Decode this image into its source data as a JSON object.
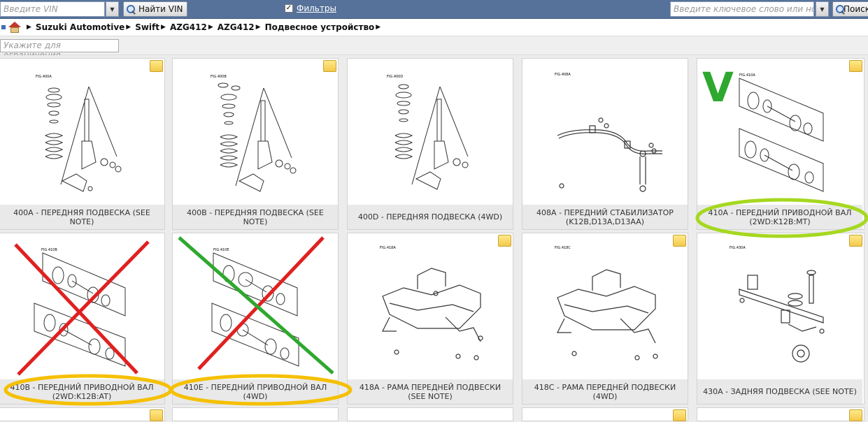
{
  "toolbar": {
    "vin_placeholder": "Введите VIN",
    "find_vin_label": "Найти VIN",
    "filter_checked": "✓",
    "filter_label": "Фильтры",
    "keyword_placeholder": "Введите ключевое слово или но...",
    "search_label": "Поиск"
  },
  "breadcrumb": [
    "Suzuki Automotive",
    "Swift",
    "AZG412",
    "AZG412",
    "Подвесное устройство"
  ],
  "filter": {
    "placeholder": "Укажите для ограничения"
  },
  "cards": [
    {
      "caption": "400A - ПЕРЕДНЯЯ ПОДВЕСКА (SEE NOTE)",
      "fig": "FIG.400A"
    },
    {
      "caption": "400B - ПЕРЕДНЯЯ ПОДВЕСКА (SEE NOTE)",
      "fig": "FIG.400B"
    },
    {
      "caption": "400D - ПЕРЕДНЯЯ ПОДВЕСКА (4WD)",
      "fig": "FIG.400D"
    },
    {
      "caption": "408A - ПЕРЕДНИЙ СТАБИЛИЗАТОР (K12B,D13A,D13AA)",
      "fig": "FIG.408A"
    },
    {
      "caption": "410A - ПЕРЕДНИЙ ПРИВОДНОЙ ВАЛ (2WD:K12B:MT)",
      "fig": "FIG.410A"
    },
    {
      "caption": "410B - ПЕРЕДНИЙ ПРИВОДНОЙ ВАЛ (2WD:K12B:AT)",
      "fig": "FIG.410B"
    },
    {
      "caption": "410E - ПЕРЕДНИЙ ПРИВОДНОЙ ВАЛ (4WD)",
      "fig": "FIG.410E"
    },
    {
      "caption": "418A - РАМА ПЕРЕДНЕЙ ПОДВЕСКИ (SEE NOTE)",
      "fig": "FIG.418A"
    },
    {
      "caption": "418C - РАМА ПЕРЕДНЕЙ ПОДВЕСКИ (4WD)",
      "fig": "FIG.418C"
    },
    {
      "caption": "430A - ЗАДНЯЯ ПОДВЕСКА (SEE NOTE)",
      "fig": "FIG.430A"
    }
  ],
  "annotations": {
    "check_mark": "V"
  },
  "colors": {
    "toolbar": "#56729a",
    "green": "#2ea82e",
    "red": "#e02020",
    "lime": "#a6d820",
    "yellow": "#f5c000"
  },
  "icons": [
    "dropdown-arrow-icon",
    "search-icon",
    "home-icon",
    "note-icon"
  ]
}
